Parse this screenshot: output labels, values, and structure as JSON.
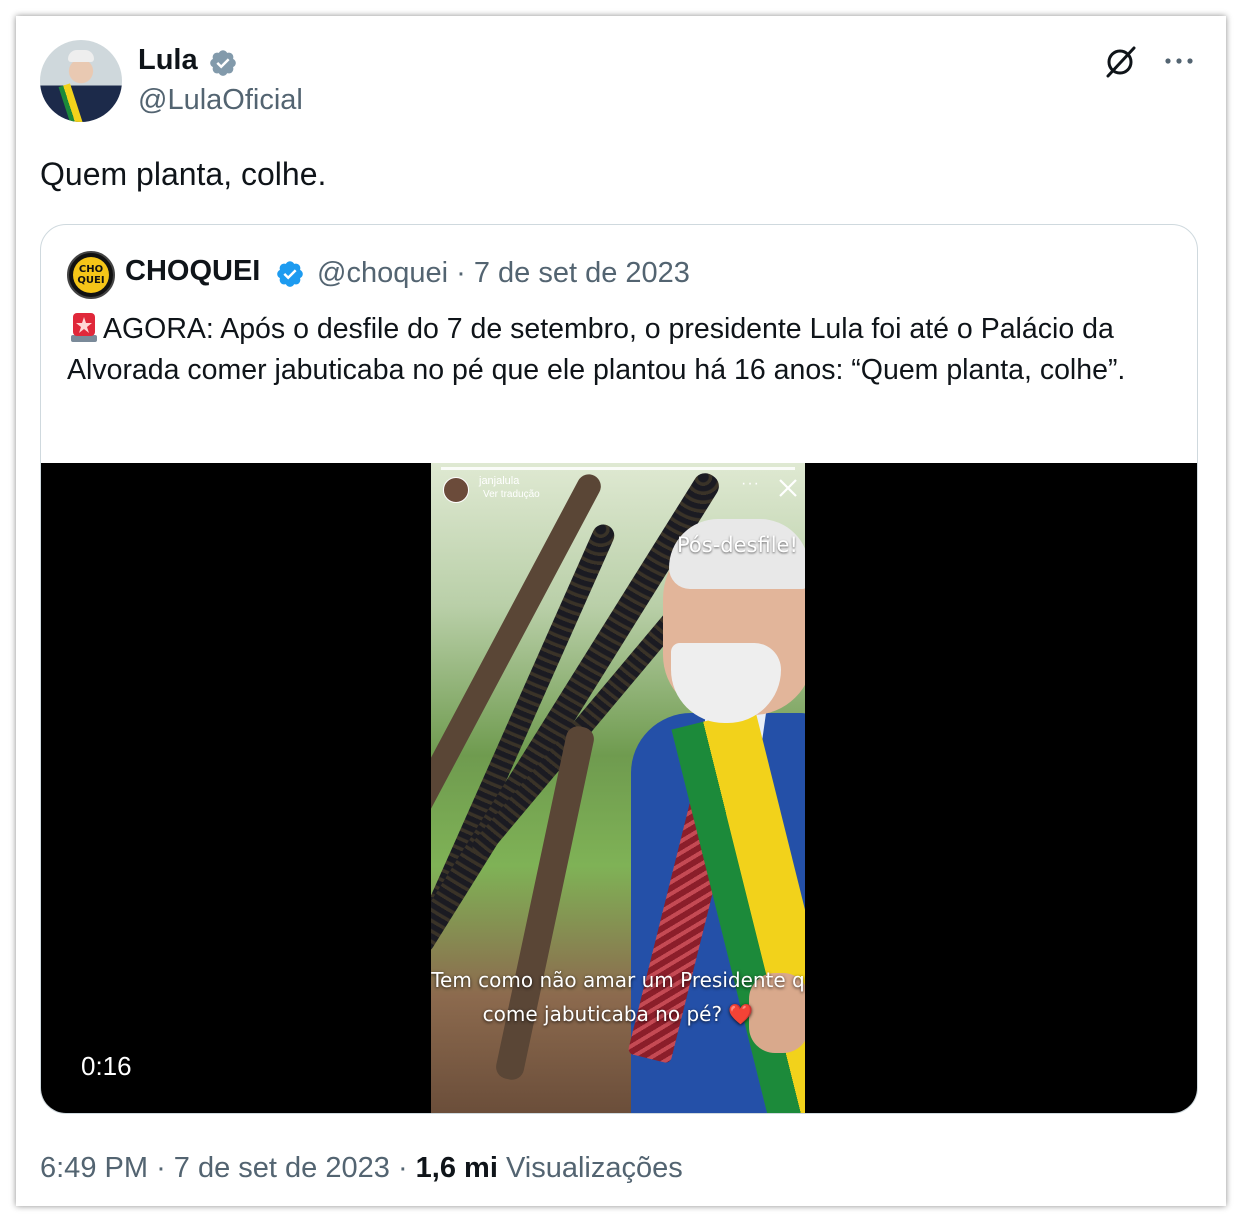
{
  "tweet": {
    "author_name": "Lula",
    "author_handle": "@LulaOficial",
    "text": "Quem planta, colhe.",
    "verified_color": "#829aab"
  },
  "header_actions": {
    "grok_icon": "grok-icon",
    "more_icon": "more-horizontal-icon"
  },
  "quoted": {
    "avatar_text_line1": "CHO",
    "avatar_text_line2": "QUEI",
    "author_name": "CHOQUEI",
    "author_handle": "@choquei",
    "separator": "·",
    "date": "7 de set de 2023",
    "verified_color": "#1d9bf0",
    "emoji": "rotating-light-icon",
    "text": "AGORA: Após o desfile do 7 de setembro, o presidente Lula foi até o Palácio da Alvorada comer jabuticaba no pé que ele plantou há 16 anos: “Quem planta, colhe”.",
    "video": {
      "duration": "0:16",
      "story_user": "janjalula",
      "story_translate": "Ver tradução",
      "caption_top": "Pós-desfile!",
      "caption_bottom_line1": "Tem como não amar um Presidente q",
      "caption_bottom_line2": "come jabuticaba no pé?",
      "caption_emoji": "❤️"
    }
  },
  "footer": {
    "time": "6:49 PM",
    "separator": "·",
    "date": "7 de set de 2023",
    "separator2": "·",
    "views_count": "1,6 mi",
    "views_label": "Visualizações"
  }
}
